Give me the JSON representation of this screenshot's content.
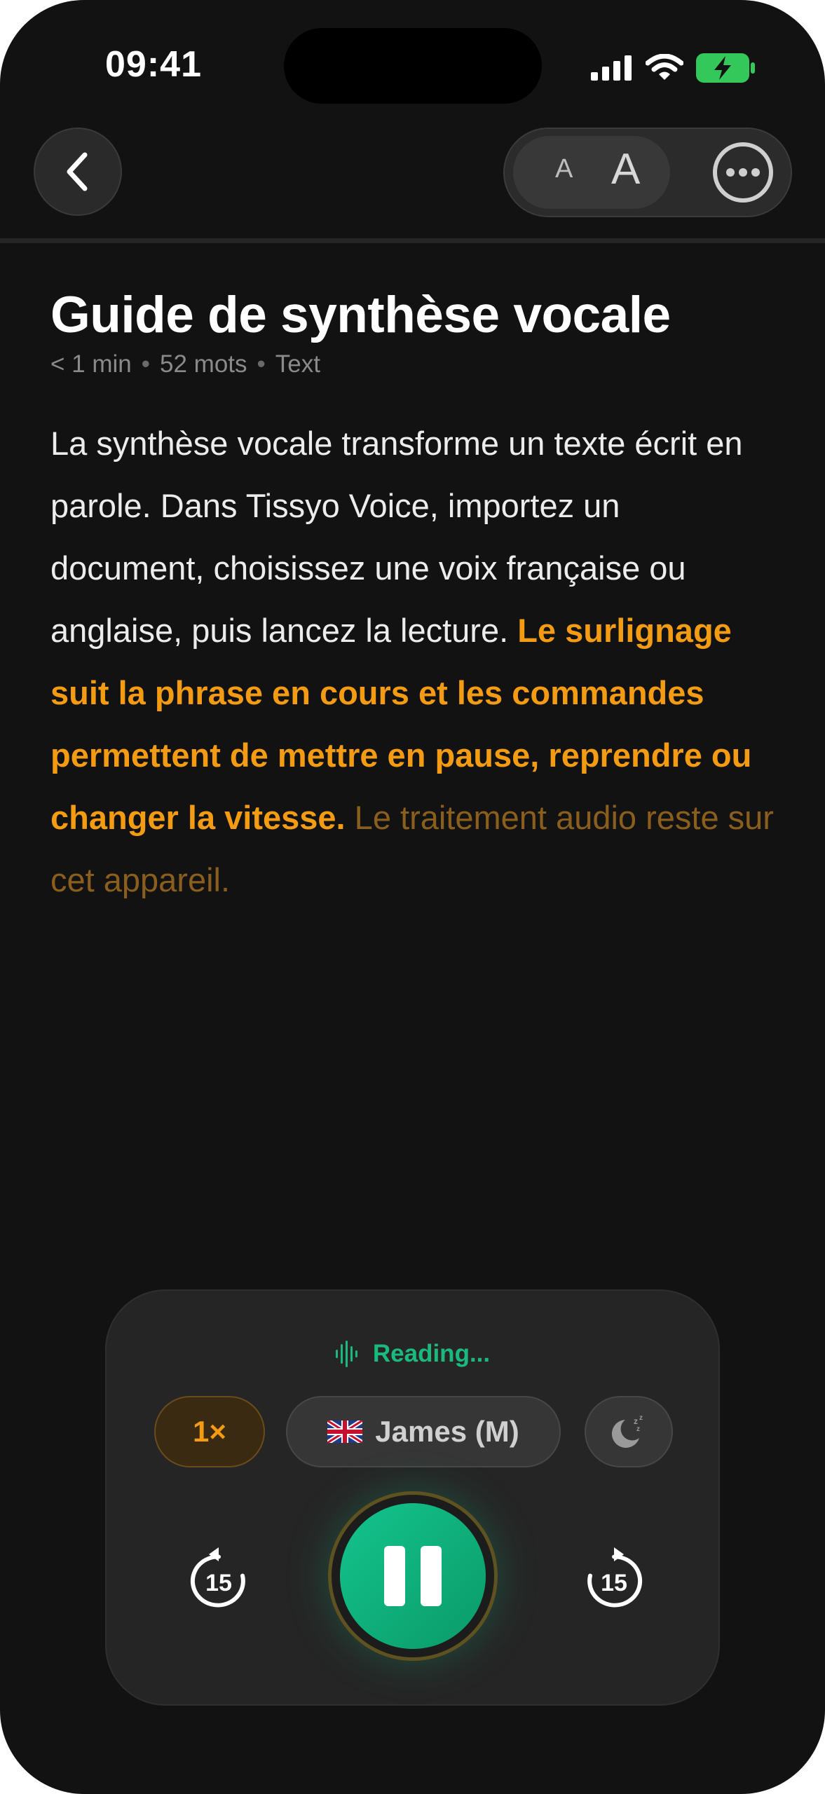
{
  "status_bar": {
    "time": "09:41",
    "icons": [
      "signal-icon",
      "wifi-icon",
      "battery-charging-icon"
    ],
    "battery_color": "#34c759"
  },
  "top_bar": {
    "back_icon": "chevron-left-icon",
    "font_small_label": "A",
    "font_large_label": "A",
    "more_icon": "ellipsis-circle-icon"
  },
  "article": {
    "title": "Guide de synthèse vocale",
    "meta": [
      "< 1 min",
      "52 mots",
      "Text"
    ],
    "text_before": "La synthèse vocale transforme un texte écrit en parole. Dans Tissyo Voice, importez un document, choisissez une voix française ou anglaise, puis lancez la lecture. ",
    "text_current": "Le surlignage suit la phrase en cours et les commandes permettent de mettre en pause, reprendre ou changer la vitesse.",
    "text_after": " Le traitement audio reste sur cet appareil.",
    "highlight_color": "#f29b13"
  },
  "player": {
    "status": "Reading...",
    "status_icon": "waveform-icon",
    "status_color": "#1cb97f",
    "speed": "1×",
    "voice_flag": "uk-flag-icon",
    "voice": "James (M)",
    "sleep_icon": "moon-zzz-icon",
    "skip_back": "15",
    "skip_forward": "15",
    "play_state": "pause",
    "accent_color": "#14c48d"
  }
}
